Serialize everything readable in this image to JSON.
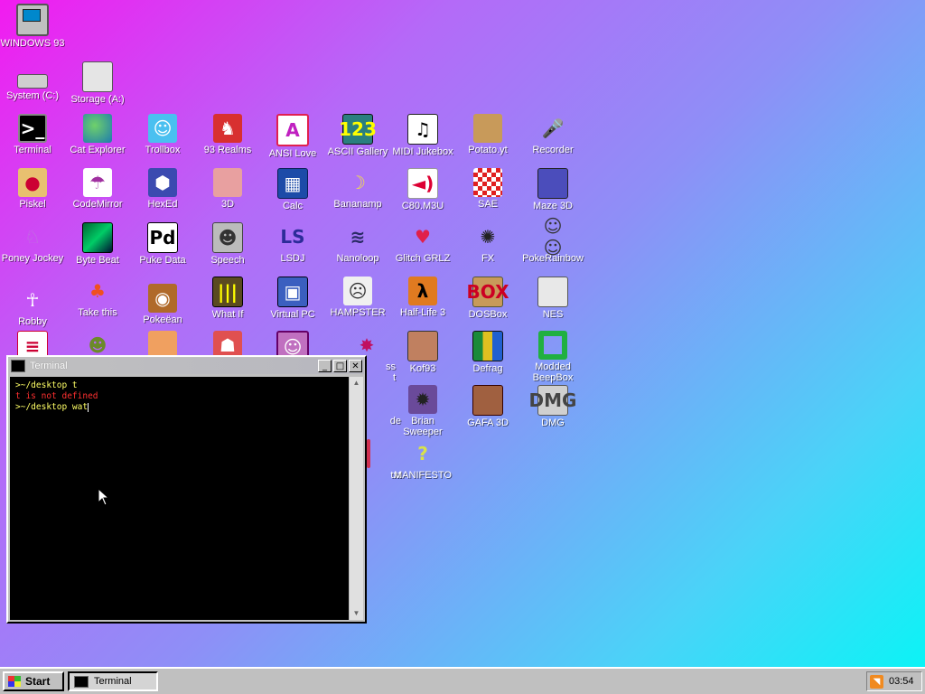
{
  "colors": {
    "terminal_prompt": "#ffff66",
    "terminal_error": "#ff3030",
    "desktop_gradient_start": "#f21bf0",
    "desktop_gradient_end": "#06f6f6"
  },
  "desktop": {
    "icons": {
      "windows93": "WINDOWS 93",
      "system_c": "System (C:)",
      "storage_a": "Storage (A:)",
      "terminal": "Terminal",
      "cat_explorer": "Cat Explorer",
      "trollbox": "Trollbox",
      "realms": "93 Realms",
      "ansi_love": "ANSI Love",
      "ascii_gallery": "ASCII Gallery",
      "midi_jukebox": "MIDI Jukebox",
      "potato": "Potato.yt",
      "recorder": "Recorder",
      "piskel": "Piskel",
      "codemirror": "CodeMirror",
      "hexed": "HexEd",
      "threed": "3D",
      "calc": "Calc",
      "bananamp": "Bananamp",
      "c80": "C80.M3U",
      "sae": "SAE",
      "maze3d": "Maze 3D",
      "poney": "Poney Jockey",
      "bytebeat": "Byte Beat",
      "puke": "Puke Data",
      "speech": "Speech",
      "lsdj": "LSDJ",
      "nanoloop": "Nanoloop",
      "glitch": "Glitch GRLZ",
      "fx": "FX",
      "pokerainbow": "PokeRainbow",
      "robby": "Robby",
      "takethis": "Take this",
      "pokeball": "Pokeëan",
      "whatif": "What If",
      "virtualpc": "Virtual PC",
      "hampster": "HAMPSTER",
      "halflife": "Half-Life 3",
      "dosbox": "DOSBox",
      "nes": "NES",
      "partial_ss": "ss",
      "partial_t": "t",
      "kof": "Kof93",
      "defrag": "Defrag",
      "beepbox": "Modded BeepBox",
      "partial_de": "de",
      "sweeper": "Brian Sweeper",
      "gafa": "GAFA 3D",
      "dmg": "DMG",
      "partial_txt": "txt",
      "manifesto": "MANIFESTO"
    }
  },
  "terminal_window": {
    "title": "Terminal",
    "lines": [
      {
        "text": ">~/desktop t",
        "kind": "prompt"
      },
      {
        "text": "t is not defined",
        "kind": "error"
      },
      {
        "text": ">~/desktop wat",
        "kind": "prompt"
      }
    ],
    "minimize_glyph": "_",
    "maximize_glyph": "□",
    "close_glyph": "✕"
  },
  "taskbar": {
    "start_label": "Start",
    "task_label": "Terminal",
    "clock": "03:54",
    "rss_glyph": "◥"
  }
}
